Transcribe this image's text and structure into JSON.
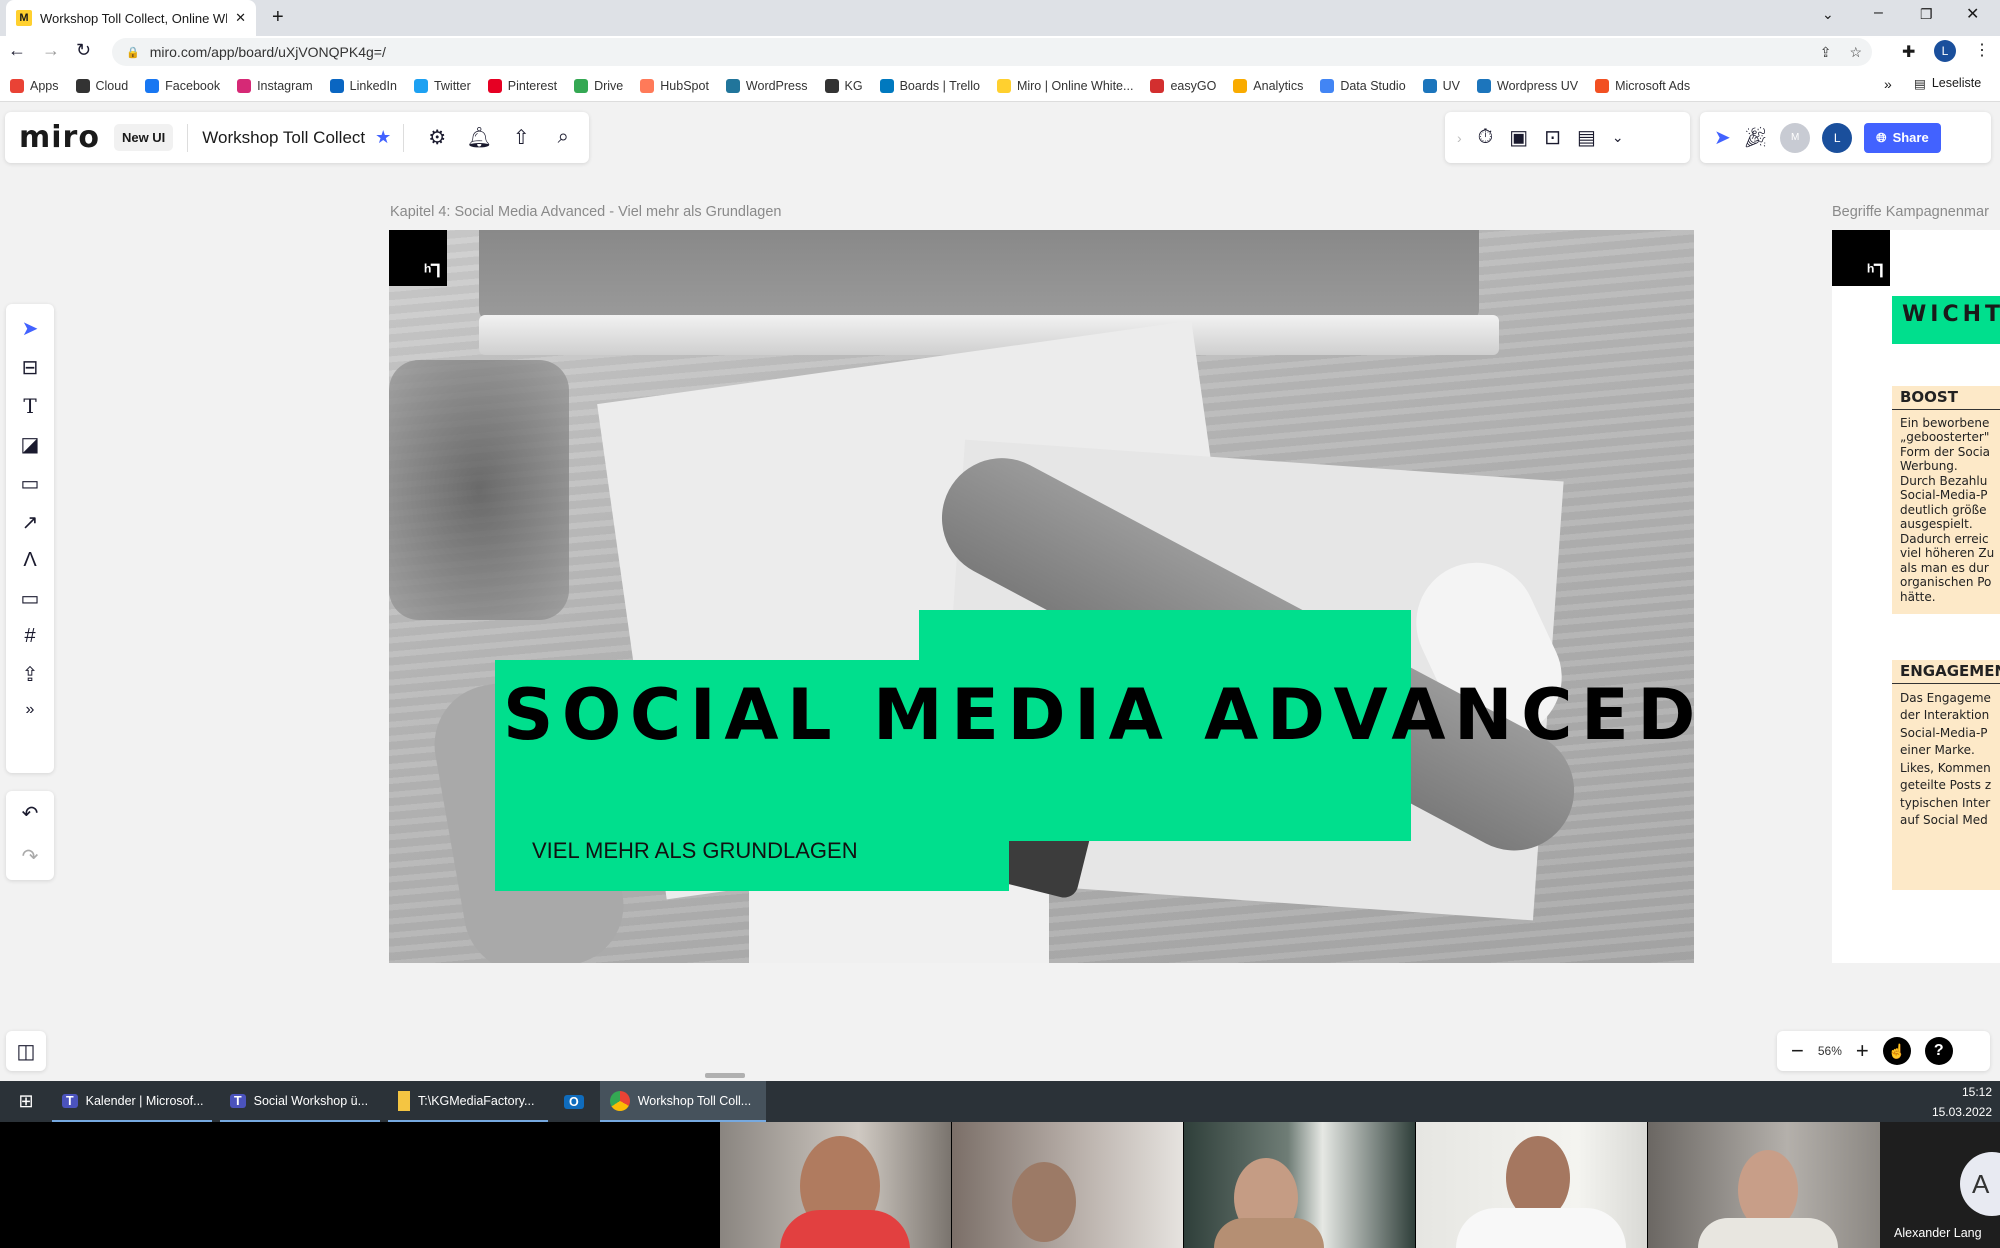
{
  "browser": {
    "tab_title": "Workshop Toll Collect, Online Wh",
    "url": "miro.com/app/board/uXjVONQPK4g=/",
    "bookmarks": [
      "Apps",
      "Cloud",
      "Facebook",
      "Instagram",
      "LinkedIn",
      "Twitter",
      "Pinterest",
      "Drive",
      "HubSpot",
      "WordPress",
      "KG",
      "Boards | Trello",
      "Miro | Online White...",
      "easyGO",
      "Analytics",
      "Data Studio",
      "UV",
      "Wordpress UV",
      "Microsoft Ads"
    ],
    "bookmark_colors": [
      "#e94235",
      "#333333",
      "#1877f2",
      "#d62976",
      "#0a66c2",
      "#1da1f2",
      "#e60023",
      "#34a853",
      "#ff7a59",
      "#21759b",
      "#333333",
      "#0079bf",
      "#ffd02f",
      "#d32f2f",
      "#f9ab00",
      "#4285f4",
      "#1c75bc",
      "#1c75bc",
      "#f25022"
    ],
    "reading_list": "Leseliste",
    "profile_initial": "L"
  },
  "miro": {
    "logo": "miro",
    "badge": "New UI",
    "board_name": "Workshop Toll Collect",
    "share_label": "Share",
    "avatar_m": "M",
    "avatar_l": "L",
    "zoom_level": "56%",
    "accent": "#4262ff"
  },
  "frames": {
    "main_title": "Kapitel 4: Social Media Advanced - Viel mehr als Grundlagen",
    "main_heading": "SOCIAL MEDIA ADVANCED",
    "main_subheading": "VIEL MEHR ALS GRUNDLAGEN",
    "green": "#00df8d",
    "side_title": "Begriffe Kampagnenmar",
    "side_heading": "WICHTI",
    "boost_title": "BOOST",
    "boost_text": [
      "Ein beworbene",
      "„geboosterter\"",
      "Form der Socia",
      "Werbung.",
      "Durch Bezahlu",
      "Social-Media-P",
      "deutlich größe",
      "ausgespielt.",
      "Dadurch erreic",
      "viel höheren Zu",
      "als man es dur",
      "organischen Po",
      "hätte."
    ],
    "engagement_title": "ENGAGEMEN",
    "engagement_text": [
      "Das Engageme",
      "der Interaktion",
      "Social-Media-P",
      "einer Marke.",
      "Likes, Kommen",
      "geteilte Posts z",
      "typischen Inter",
      "auf Social Med"
    ]
  },
  "taskbar": {
    "items": [
      "Kalender | Microsof...",
      "Social Workshop ü...",
      "T:\\KGMediaFactory...",
      "",
      "Workshop Toll Coll..."
    ],
    "time": "15:12",
    "date": "15.03.2022"
  },
  "video": {
    "participant_name": "Alexander Lang",
    "participant_initial": "A"
  }
}
